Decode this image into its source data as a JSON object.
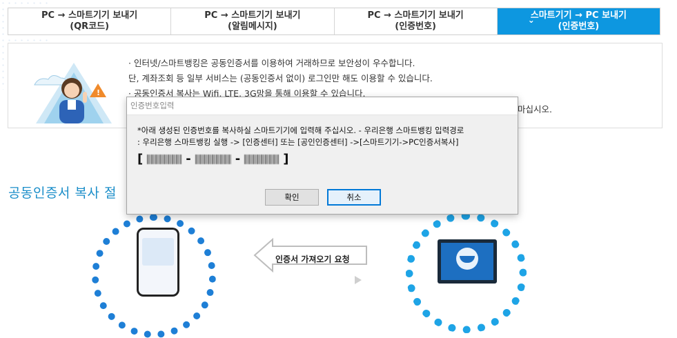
{
  "tabs": [
    {
      "line1": "PC → 스마트기기 보내기",
      "line2": "(QR코드)",
      "active": false
    },
    {
      "line1": "PC → 스마트기기 보내기",
      "line2": "(알림메시지)",
      "active": false
    },
    {
      "line1": "PC → 스마트기기 보내기",
      "line2": "(인증번호)",
      "active": false
    },
    {
      "line1": "스마트기기 → PC 보내기",
      "line2": "(인증번호)",
      "active": true,
      "chevron": "⌄"
    }
  ],
  "info": {
    "line1": "· 인터넷/스마트뱅킹은 공동인증서를 이용하여 거래하므로 보안성이 우수합니다.",
    "line2": "  단, 계좌조회 등 일부 서비스는 (공동인증서 없이) 로그인만 해도 이용할 수 있습니다.",
    "line3": "· 공동인증서 복사는 Wifi, LTE, 3G망을 통해 이용할 수 있습니다.",
    "trailing": "마십시오."
  },
  "section_title": "공동인증서 복사 절",
  "diagram": {
    "arrow_label": "인증서 가져오기 요청"
  },
  "dialog": {
    "title": "인증번호입력",
    "message_line1": "*아래 생성된 인증번호를 복사하실 스마트기기에 입력해 주십시오. - 우리은행 스마트뱅킹 입력경로",
    "message_line2": ": 우리은행 스마트뱅킹 실행 -> [인증센터] 또는 [공인인증센터] ->[스마트기기->PC인증서복사]",
    "code_open": "[",
    "code_dash1": "-",
    "code_dash2": "-",
    "code_close": "]",
    "ok_label": "확인",
    "cancel_label": "취소"
  },
  "colors": {
    "active_tab": "#0d97e0",
    "section_title": "#1b8ec9",
    "circle_left": "#1e7fd6",
    "circle_right": "#1ea4e6"
  }
}
